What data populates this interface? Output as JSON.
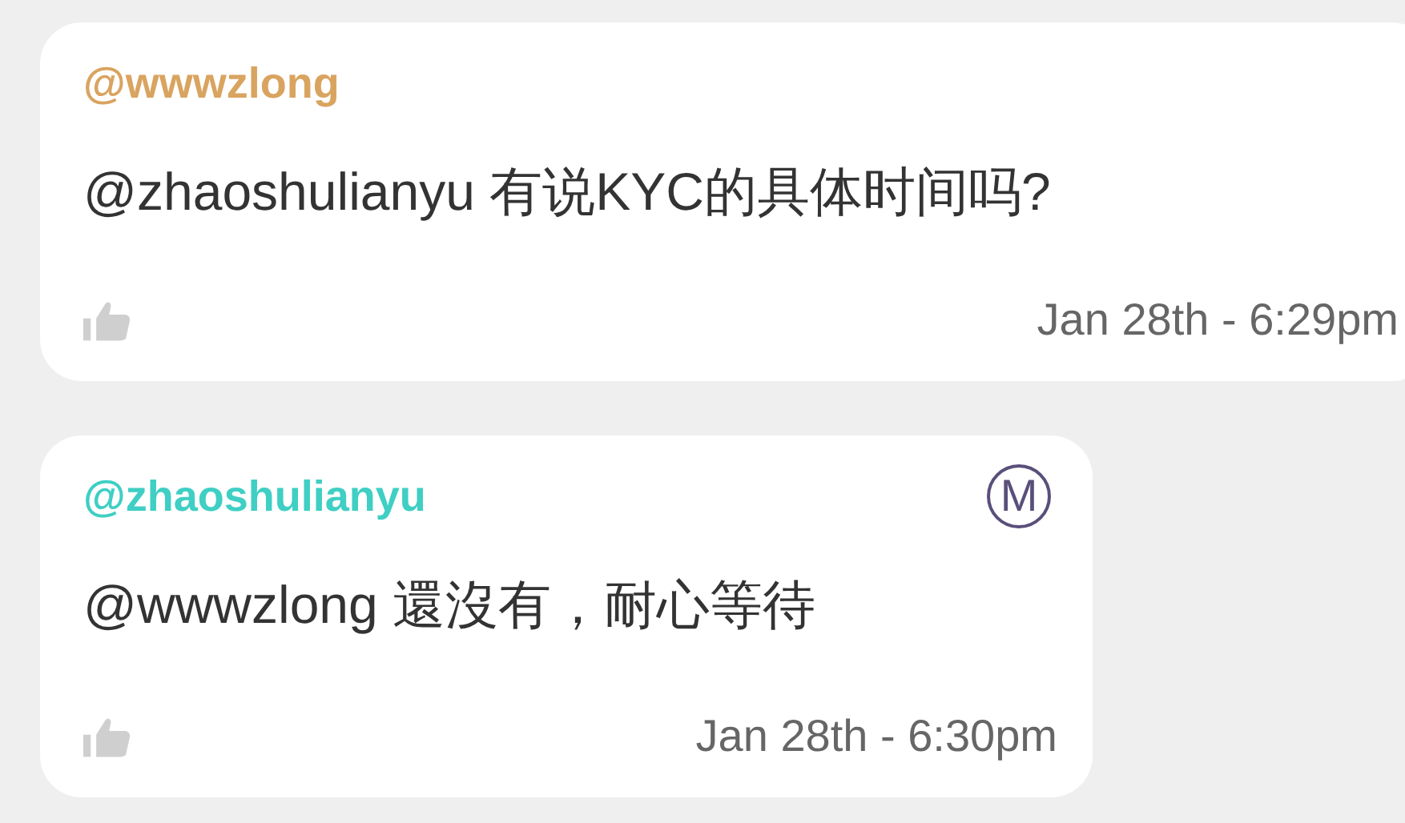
{
  "messages": [
    {
      "username": "@wwwzlong",
      "color": "#d9a460",
      "text": "@zhaoshulianyu 有说KYC的具体时间吗?",
      "timestamp": "Jan 28th - 6:29pm"
    },
    {
      "username": "@zhaoshulianyu",
      "color": "#3fcfc4",
      "badge": "M",
      "text": "@wwwzlong 還沒有，耐心等待",
      "timestamp": "Jan 28th - 6:30pm"
    }
  ]
}
